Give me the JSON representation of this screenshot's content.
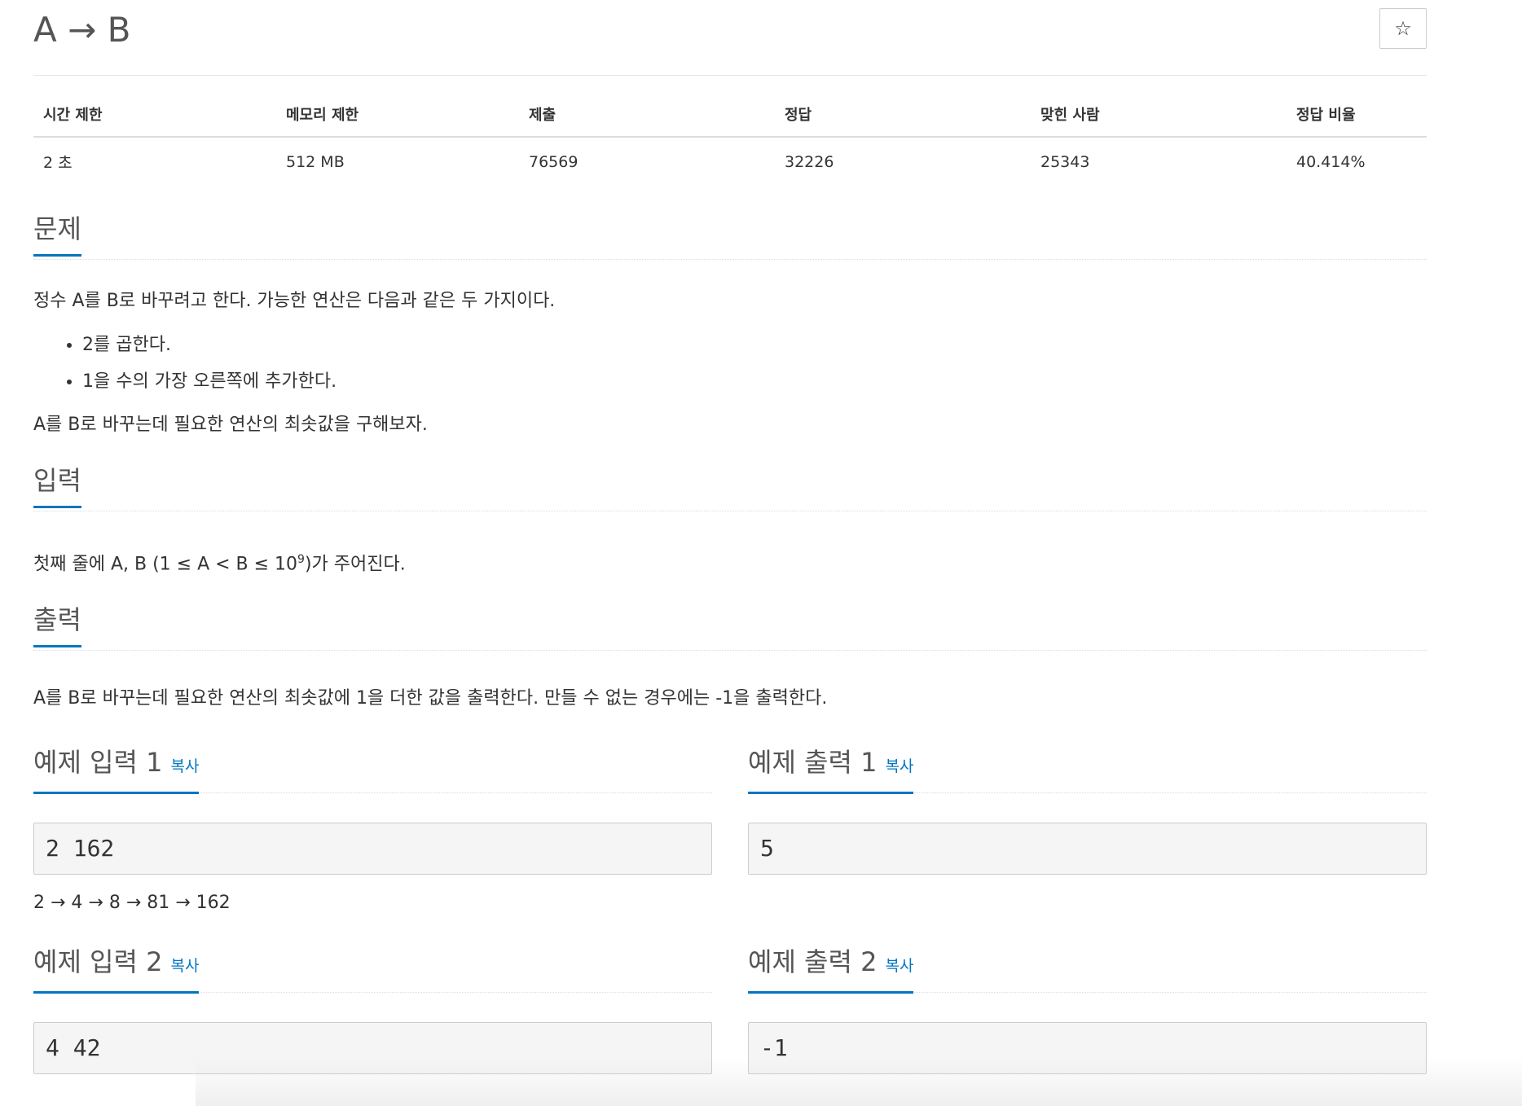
{
  "problem": {
    "title": "A → B",
    "star_icon": "☆"
  },
  "info": {
    "headers": [
      "시간 제한",
      "메모리 제한",
      "제출",
      "정답",
      "맞힌 사람",
      "정답 비율"
    ],
    "values": [
      "2 초",
      "512 MB",
      "76569",
      "32226",
      "25343",
      "40.414%"
    ]
  },
  "description": {
    "heading": "문제",
    "intro": "정수 A를 B로 바꾸려고 한다. 가능한 연산은 다음과 같은 두 가지이다.",
    "items": [
      "2를 곱한다.",
      "1을 수의 가장 오른쪽에 추가한다."
    ],
    "outro": "A를 B로 바꾸는데 필요한 연산의 최솟값을 구해보자."
  },
  "input": {
    "heading": "입력",
    "text_before": "첫째 줄에 A, B (1 ≤ A < B ≤ 10",
    "superscript": "9",
    "text_after": ")가 주어진다."
  },
  "output": {
    "heading": "출력",
    "text": "A를 B로 바꾸는데 필요한 연산의 최솟값에 1을 더한 값을 출력한다. 만들 수 없는 경우에는 -1을 출력한다."
  },
  "samples": {
    "copy_label": "복사",
    "input1": {
      "title": "예제 입력 1",
      "value": "2 162"
    },
    "output1": {
      "title": "예제 출력 1",
      "value": "5"
    },
    "note1": "2 → 4 → 8 → 81 → 162",
    "input2": {
      "title": "예제 입력 2",
      "value": "4 42"
    },
    "output2": {
      "title": "예제 출력 2",
      "value": "-1"
    }
  },
  "colors": {
    "accent": "#0076c0",
    "heading_text": "#555555",
    "body_text": "#333333",
    "sample_bg": "#f5f5f5"
  }
}
